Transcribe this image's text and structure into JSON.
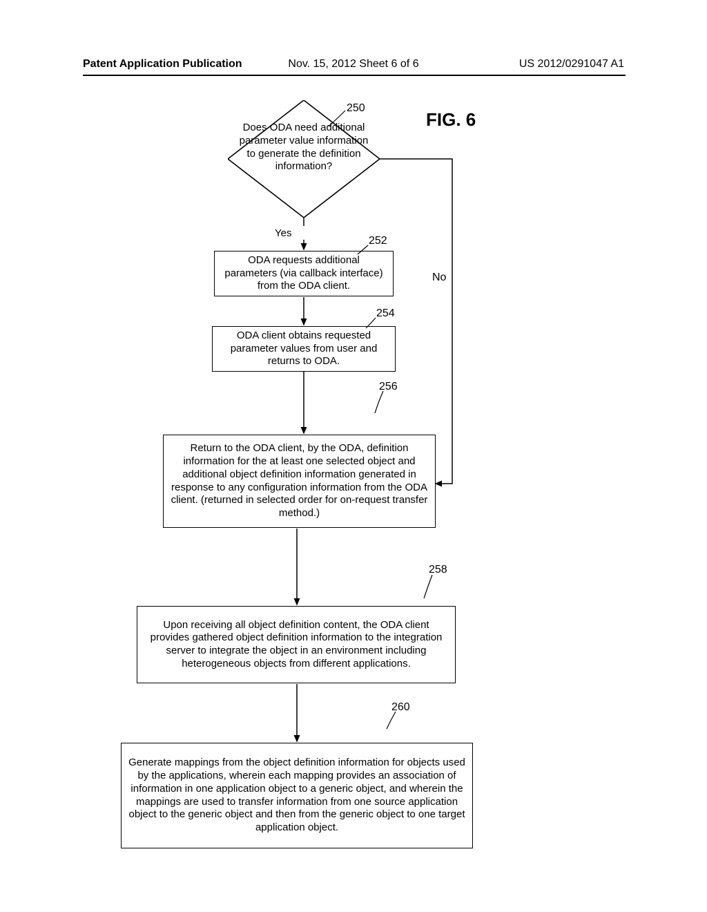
{
  "header": {
    "left": "Patent Application Publication",
    "center": "Nov. 15, 2012  Sheet 6 of 6",
    "right": "US 2012/0291047 A1"
  },
  "figure_label": "FIG. 6",
  "refs": {
    "r250": "250",
    "r252": "252",
    "r254": "254",
    "r256": "256",
    "r258": "258",
    "r260": "260"
  },
  "labels": {
    "yes": "Yes",
    "no": "No"
  },
  "blocks": {
    "diamond": "Does ODA need additional parameter value information to generate the definition information?",
    "b252": "ODA requests additional parameters (via callback interface) from the ODA client.",
    "b254": "ODA client obtains requested parameter values from user and returns to ODA.",
    "b256": "Return to the ODA client, by the ODA, definition information for the at least one selected object and additional object definition information generated in response to any configuration information from the ODA client.  (returned in selected order for on-request transfer method.)",
    "b258": "Upon receiving all object definition content, the ODA client provides gathered object definition information to the integration server to integrate the object in an environment including heterogeneous objects from different applications.",
    "b260": "Generate mappings from the object definition information for objects used by the applications, wherein each mapping provides an association of information in one application object to a generic object, and wherein the mappings are used to transfer information from one source application object to the generic object and then from the generic object to one target application object."
  },
  "chart_data": {
    "type": "flowchart",
    "nodes": [
      {
        "id": "250",
        "type": "decision",
        "text": "Does ODA need additional parameter value information to generate the definition information?"
      },
      {
        "id": "252",
        "type": "process",
        "text": "ODA requests additional parameters (via callback interface) from the ODA client."
      },
      {
        "id": "254",
        "type": "process",
        "text": "ODA client obtains requested parameter values from user and returns to ODA."
      },
      {
        "id": "256",
        "type": "process",
        "text": "Return to the ODA client, by the ODA, definition information for the at least one selected object and additional object definition information generated in response to any configuration information from the ODA client.  (returned in selected order for on-request transfer method.)"
      },
      {
        "id": "258",
        "type": "process",
        "text": "Upon receiving all object definition content, the ODA client provides gathered object definition information to the integration server to integrate the object in an environment including heterogeneous objects from different applications."
      },
      {
        "id": "260",
        "type": "process",
        "text": "Generate mappings from the object definition information for objects used by the applications, wherein each mapping provides an association of information in one application object to a generic object, and wherein the mappings are used to transfer information from one source application object to the generic object and then from the generic object to one target application object."
      }
    ],
    "edges": [
      {
        "from": "250",
        "to": "252",
        "label": "Yes"
      },
      {
        "from": "250",
        "to": "256",
        "label": "No"
      },
      {
        "from": "252",
        "to": "254",
        "label": ""
      },
      {
        "from": "254",
        "to": "256",
        "label": ""
      },
      {
        "from": "256",
        "to": "258",
        "label": ""
      },
      {
        "from": "258",
        "to": "260",
        "label": ""
      }
    ]
  }
}
